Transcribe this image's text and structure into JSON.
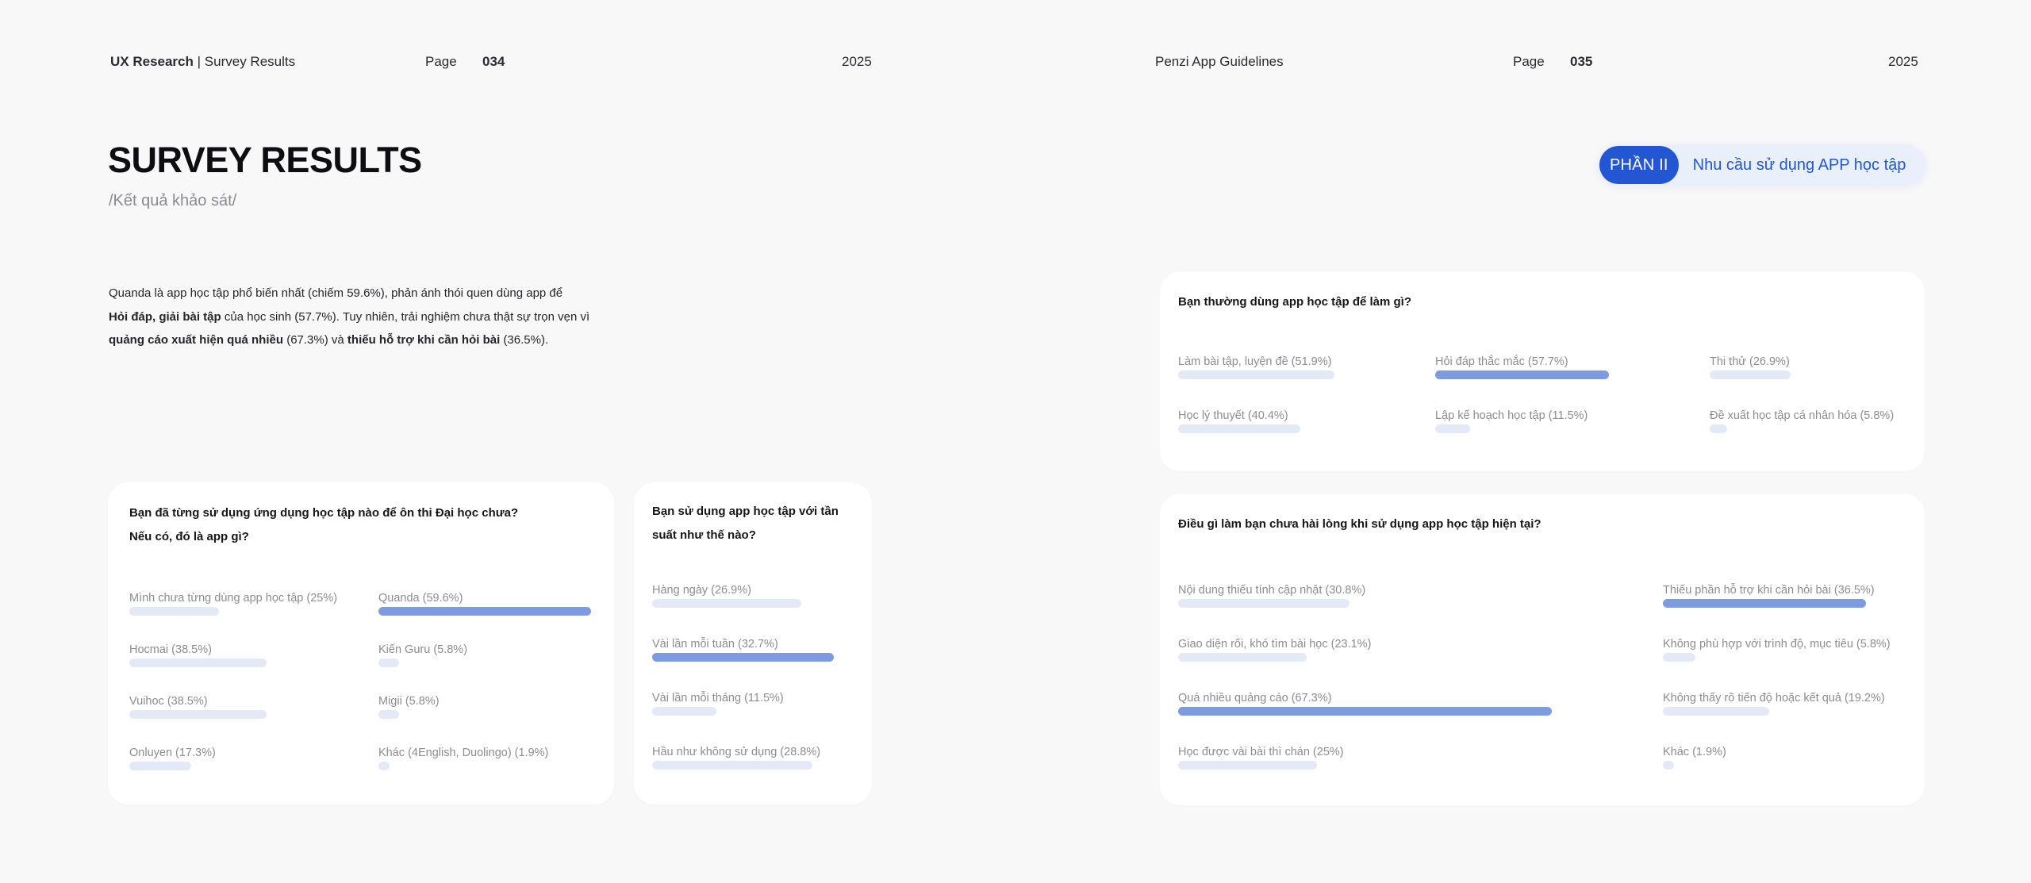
{
  "header": {
    "left": {
      "brand": "UX Research",
      "separator": "|",
      "section": "Survey Results",
      "page_label": "Page",
      "page_number": "034",
      "year": "2025"
    },
    "right": {
      "title": "Penzi App Guidelines",
      "page_label": "Page",
      "page_number": "035",
      "year": "2025"
    }
  },
  "title": "SURVEY RESULTS",
  "subtitle": "/Kết quả khảo sát/",
  "section": {
    "number": "PHẦN II",
    "label": "Nhu cầu sử dụng APP học tập"
  },
  "intro": {
    "t1": "Quanda là app học tập phổ biến nhất (chiếm 59.6%), phản ánh thói quen dùng app để",
    "b1": "Hỏi đáp, giải bài tập",
    "t2": " của học sinh (57.7%). Tuy nhiên, trải nghiệm chưa thật sự trọn vẹn vì ",
    "b2": "quảng cáo xuất hiện quá nhiều",
    "t3": " (67.3%) và ",
    "b3": "thiếu hỗ trợ khi cần hỏi bài",
    "t4": " (36.5%)."
  },
  "cards": {
    "apps": {
      "question_line1": "Bạn đã từng sử dụng ứng dụng học tập nào để ôn thi Đại học chưa?",
      "question_line2": "Nếu có, đó là app gì?",
      "options": [
        {
          "label": "Mình chưa từng dùng app học tập (25%)",
          "value": 25.0,
          "highlight": false
        },
        {
          "label": "Quanda (59.6%)",
          "value": 59.6,
          "highlight": true
        },
        {
          "label": "Hocmai (38.5%)",
          "value": 38.5,
          "highlight": false
        },
        {
          "label": "Kiến Guru  (5.8%)",
          "value": 5.8,
          "highlight": false
        },
        {
          "label": "Vuihoc (38.5%)",
          "value": 38.5,
          "highlight": false
        },
        {
          "label": "Migii (5.8%)",
          "value": 5.8,
          "highlight": false
        },
        {
          "label": "Onluyen (17.3%)",
          "value": 17.3,
          "highlight": false
        },
        {
          "label": "Khác (4English, Duolingo) (1.9%)",
          "value": 1.9,
          "highlight": false
        }
      ]
    },
    "frequency": {
      "question_line1": "Bạn sử dụng app học tập với tần",
      "question_line2": "suất như thế nào?",
      "options": [
        {
          "label": "Hàng ngày (26.9%)",
          "value": 26.9,
          "highlight": false
        },
        {
          "label": "Vài lần mỗi tuần (32.7%)",
          "value": 32.7,
          "highlight": true
        },
        {
          "label": "Vài lần mỗi tháng (11.5%)",
          "value": 11.5,
          "highlight": false
        },
        {
          "label": "Hầu như không sử dụng (28.8%)",
          "value": 28.8,
          "highlight": false
        }
      ]
    },
    "purpose": {
      "question": "Bạn thường dùng app học tập để làm gì?",
      "options": [
        {
          "label": "Làm bài tập, luyện đề (51.9%)",
          "value": 51.9,
          "highlight": false
        },
        {
          "label": "Hỏi đáp thắc mắc (57.7%)",
          "value": 57.7,
          "highlight": true
        },
        {
          "label": "Thi thử (26.9%)",
          "value": 26.9,
          "highlight": false
        },
        {
          "label": "Học lý thuyết (40.4%)",
          "value": 40.4,
          "highlight": false
        },
        {
          "label": "Lập kế hoạch học tập (11.5%)",
          "value": 11.5,
          "highlight": false
        },
        {
          "label": "Đề xuất học tập cá nhân hóa (5.8%)",
          "value": 5.8,
          "highlight": false
        }
      ]
    },
    "dissatisfaction": {
      "question": "Điều gì làm bạn chưa hài lòng khi sử dụng app học tập hiện tại?",
      "options": [
        {
          "label": "Nội dung thiếu tính cập nhật (30.8%)",
          "value": 30.8,
          "highlight": false
        },
        {
          "label": "Thiếu phần hỗ trợ khi cần hỏi bài (36.5%)",
          "value": 36.5,
          "highlight": true
        },
        {
          "label": "Giao diện rối, khó tìm bài học (23.1%)",
          "value": 23.1,
          "highlight": false
        },
        {
          "label": "Không phù hợp với trình độ, mục tiêu (5.8%)",
          "value": 5.8,
          "highlight": false
        },
        {
          "label": "Quá nhiều quảng cáo (67.3%)",
          "value": 67.3,
          "highlight": true
        },
        {
          "label": "Không thấy rõ tiến độ hoặc kết quả (19.2%)",
          "value": 19.2,
          "highlight": false
        },
        {
          "label": "Học được vài bài thì chán (25%)",
          "value": 25.0,
          "highlight": false
        },
        {
          "label": "Khác (1.9%)",
          "value": 1.9,
          "highlight": false
        }
      ]
    }
  }
}
